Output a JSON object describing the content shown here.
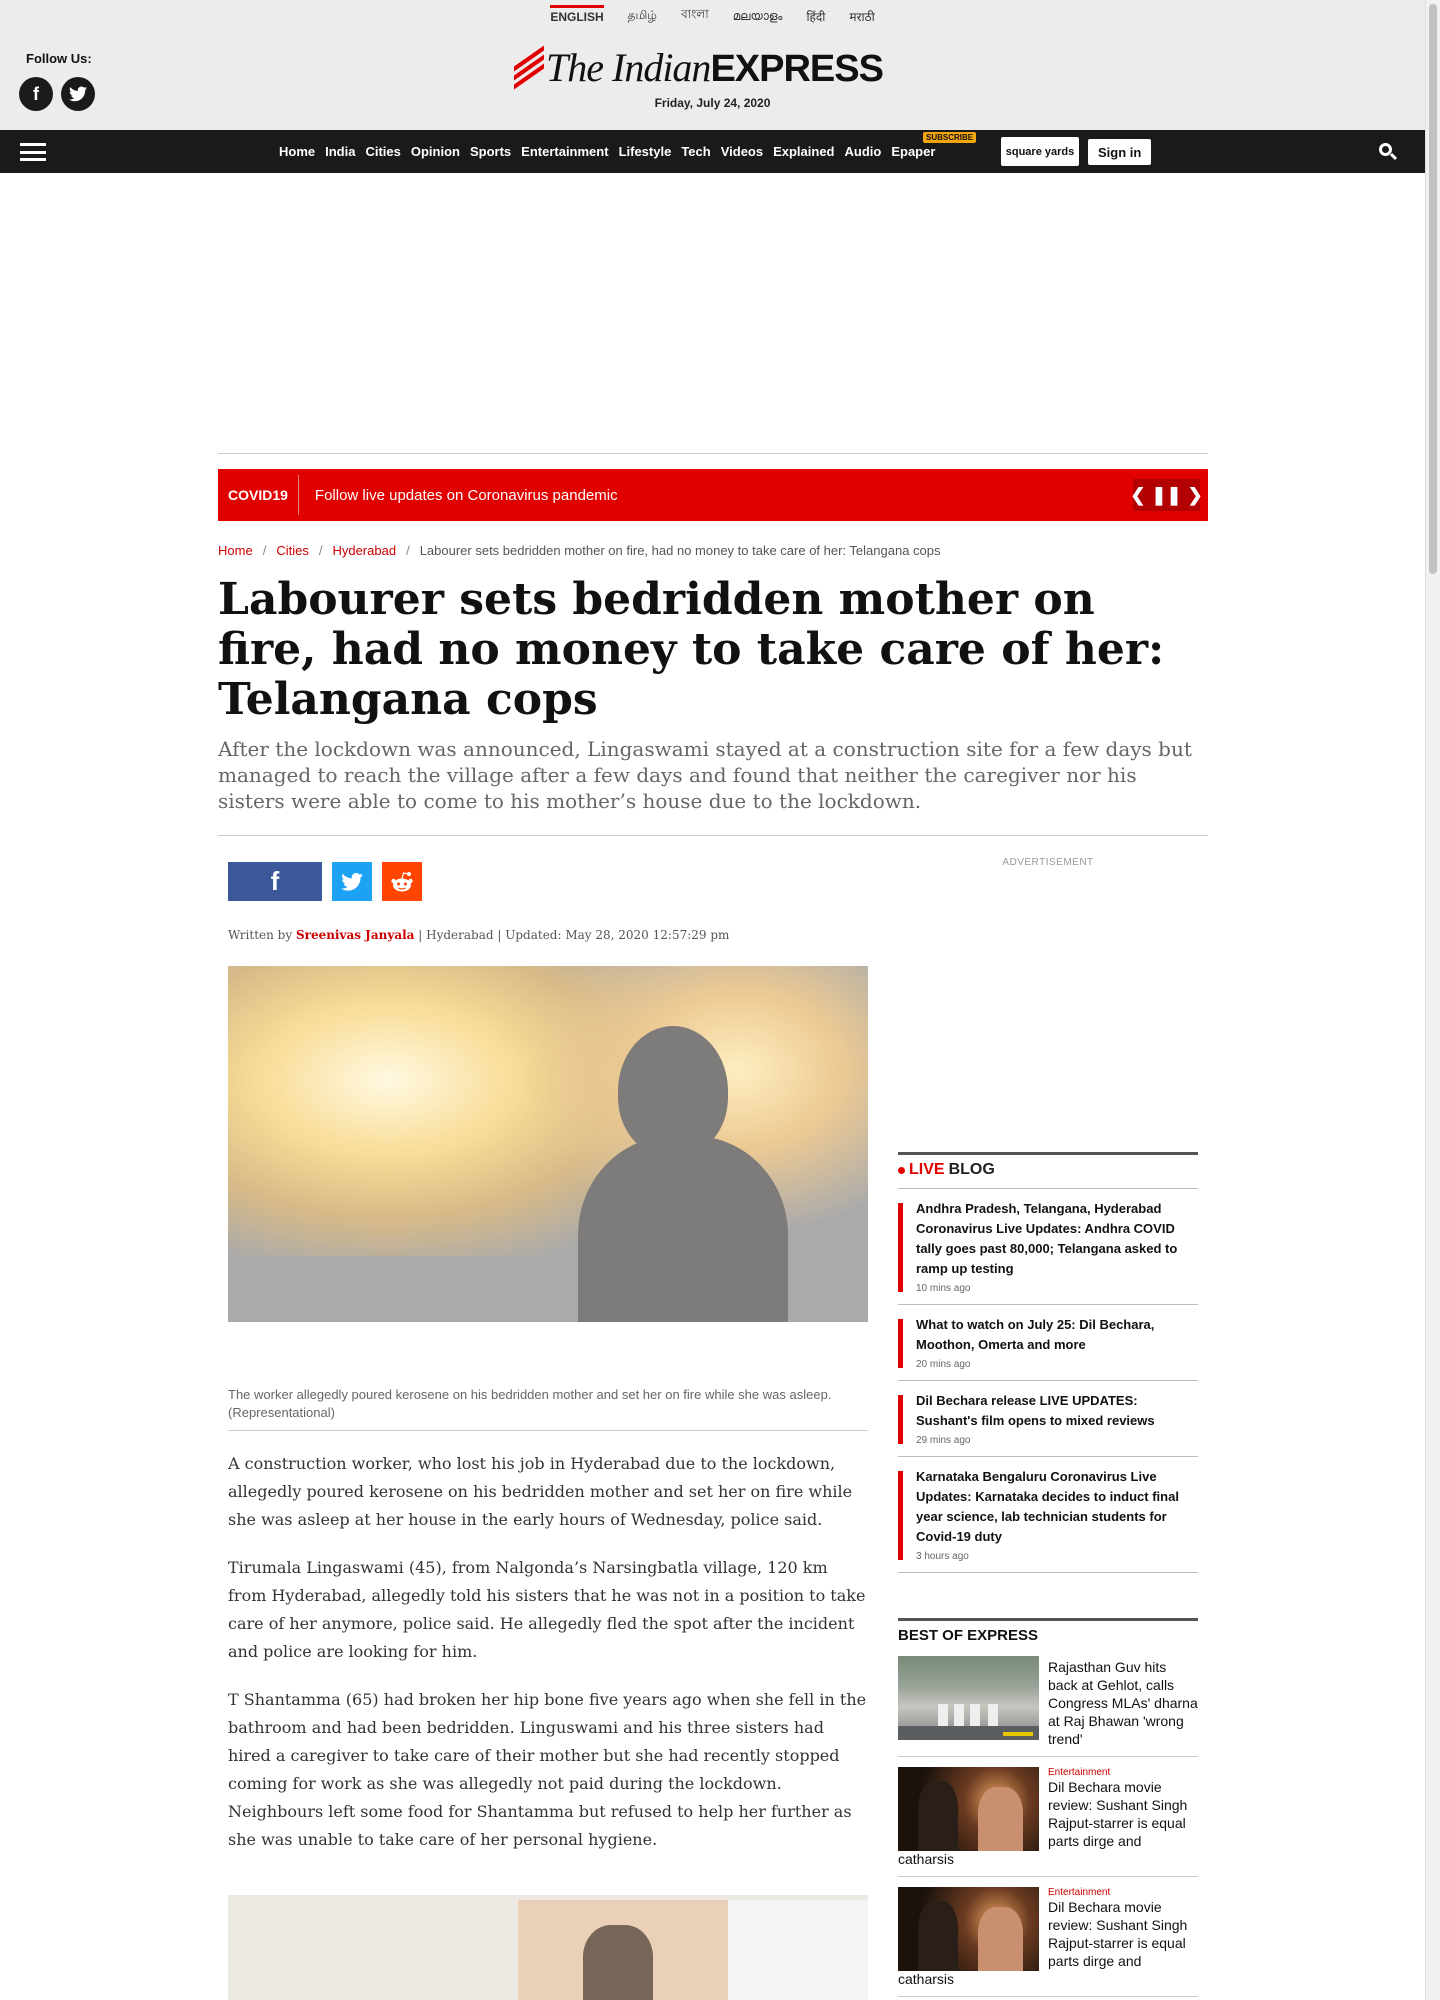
{
  "languages": [
    "ENGLISH",
    "தமிழ்",
    "বাংলা",
    "മലയാളം",
    "हिंदी",
    "मराठी"
  ],
  "follow_label": "Follow Us:",
  "social": {
    "facebook": "f",
    "twitter": "t"
  },
  "logo": {
    "italic": "The Indian",
    "bold": "EXPRESS"
  },
  "date": "Friday, July 24, 2020",
  "nav": [
    "Home",
    "India",
    "Cities",
    "Opinion",
    "Sports",
    "Entertainment",
    "Lifestyle",
    "Tech",
    "Videos",
    "Explained",
    "Audio",
    "Epaper"
  ],
  "subscribe_badge": "SUBSCRIBE",
  "square_yards": "square yards",
  "signin": "Sign in",
  "covid": {
    "tag": "COVID19",
    "message": "Follow live updates on Coronavirus pandemic"
  },
  "breadcrumb": [
    "Home",
    "Cities",
    "Hyderabad",
    "Labourer sets bedridden mother on fire, had no money to take care of her: Telangana cops"
  ],
  "headline": "Labourer sets bedridden mother on fire, had no money to take care of her: Telangana cops",
  "synopsis": "After the lockdown was announced, Lingaswami stayed at a construction site for a few days but managed to reach the village after a few days and found that neither the caregiver nor his sisters were able to come to his mother’s house due to the lockdown.",
  "byline": {
    "prefix": "Written by",
    "author": "Sreenivas Janyala",
    "location": "Hyderabad",
    "updated": "Updated: May 28, 2020 12:57:29 pm"
  },
  "caption": "The worker allegedly poured kerosene on his bedridden mother and set her on fire while she was asleep. (Representational)",
  "body": [
    "A construction worker, who lost his job in Hyderabad due to the lockdown, allegedly poured kerosene on his bedridden mother and set her on fire while she was asleep at her house in the early hours of Wednesday, police said.",
    "Tirumala Lingaswami (45), from Nalgonda’s Narsingbatla village, 120 km from Hyderabad, allegedly told his sisters that he was not in a position to take care of her anymore, police said. He allegedly fled the spot after the incident and police are looking for him.",
    "T Shantamma (65) had broken her hip bone five years ago when she fell in the bathroom and had been bedridden. Linguswami and his three sisters had hired a caregiver to take care of their mother but she had recently stopped coming for work as she was allegedly not paid during the lockdown. Neighbours left some food for Shantamma but refused to help her further as she was unable to take care of her personal hygiene."
  ],
  "advertisement_label": "ADVERTISEMENT",
  "live_blog": {
    "live": "LIVE",
    "blog": "BLOG",
    "items": [
      {
        "title": "Andhra Pradesh, Telangana, Hyderabad Coronavirus Live Updates: Andhra COVID tally goes past 80,000; Telangana asked to ramp up testing",
        "ago": "10 mins ago"
      },
      {
        "title": "What to watch on July 25: Dil Bechara, Moothon, Omerta and more",
        "ago": "20 mins ago"
      },
      {
        "title": "Dil Bechara release LIVE UPDATES: Sushant's film opens to mixed reviews",
        "ago": "29 mins ago"
      },
      {
        "title": "Karnataka Bengaluru Coronavirus Live Updates: Karnataka decides to induct final year science, lab technician students for Covid-19 duty",
        "ago": "3 hours ago"
      }
    ]
  },
  "best_of": {
    "heading": "BEST OF EXPRESS",
    "items": [
      {
        "category": "",
        "title": "Rajasthan Guv hits back at Gehlot, calls Congress MLAs' dharna at Raj Bhawan 'wrong trend'",
        "tail": ""
      },
      {
        "category": "Entertainment",
        "title": "Dil Bechara movie review: Sushant Singh Rajput-starrer is equal parts dirge and",
        "tail": "catharsis"
      },
      {
        "category": "Entertainment",
        "title": "Dil Bechara movie review: Sushant Singh Rajput-starrer is equal parts dirge and",
        "tail": "catharsis"
      }
    ]
  }
}
